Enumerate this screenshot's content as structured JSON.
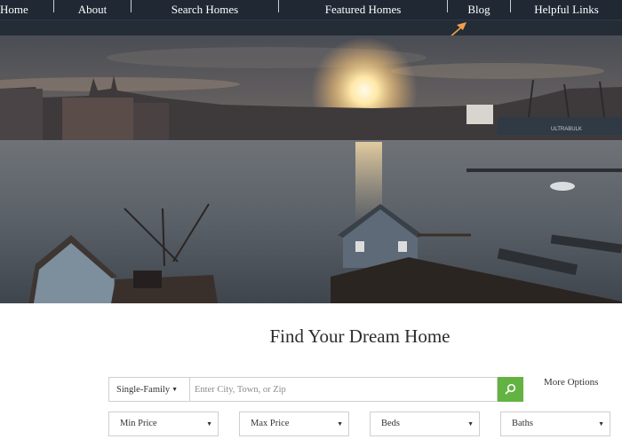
{
  "nav": {
    "items": [
      {
        "label": "Home"
      },
      {
        "label": "About"
      },
      {
        "label": "Search Homes"
      },
      {
        "label": "Featured Homes"
      },
      {
        "label": "Blog"
      },
      {
        "label": "Helpful Links"
      }
    ],
    "caret_icon": "caret-down-icon",
    "annotation_arrow_color": "#f0a04b"
  },
  "hero": {
    "image": "harbor-sunset-photo",
    "ship_text": "ULTRABULK"
  },
  "search": {
    "heading": "Find Your Dream Home",
    "property_type": "Single-Family",
    "location_placeholder": "Enter City, Town, or Zip",
    "search_icon": "search-icon",
    "search_button_color": "#62b342",
    "more_options": "More Options",
    "filters": [
      {
        "label": "Min Price"
      },
      {
        "label": "Max Price"
      },
      {
        "label": "Beds"
      },
      {
        "label": "Baths"
      }
    ]
  }
}
